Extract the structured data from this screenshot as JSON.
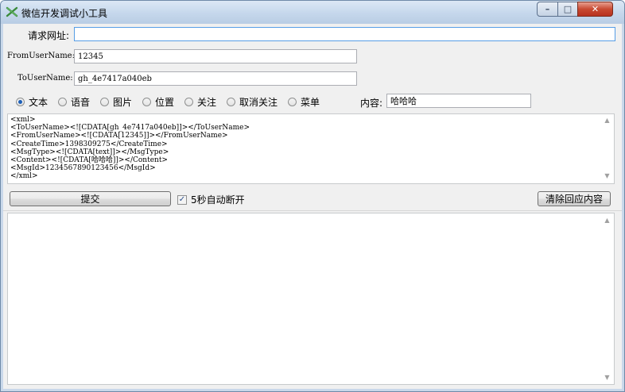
{
  "window": {
    "title": "微信开发调试小工具",
    "controls": {
      "minimize": "–",
      "maximize": "□",
      "close": "✕"
    }
  },
  "form": {
    "url_label": "请求网址:",
    "url_value": "",
    "from_label": "FromUserName:",
    "from_value": "12345",
    "to_label": "ToUserName:",
    "to_value": "gh_4e7417a040eb",
    "content_label": "内容:",
    "content_value": "哈哈哈"
  },
  "message_types": [
    {
      "label": "文本",
      "checked": true
    },
    {
      "label": "语音",
      "checked": false
    },
    {
      "label": "图片",
      "checked": false
    },
    {
      "label": "位置",
      "checked": false
    },
    {
      "label": "关注",
      "checked": false
    },
    {
      "label": "取消关注",
      "checked": false
    },
    {
      "label": "菜单",
      "checked": false
    }
  ],
  "xml_lines": [
    "<xml>",
    "<ToUserName><![CDATA[gh_4e7417a040eb]]></ToUserName>",
    "<FromUserName><![CDATA[12345]]></FromUserName>",
    "<CreateTime>1398309275</CreateTime>",
    "<MsgType><![CDATA[text]]></MsgType>",
    "<Content><![CDATA[哈哈哈]]></Content>",
    "<MsgId>1234567890123456</MsgId>",
    "</xml>"
  ],
  "actions": {
    "submit_label": "提交",
    "auto_disconnect_label": "5秒自动断开",
    "auto_disconnect_checked": true,
    "clear_label": "清除回应内容"
  },
  "response": {
    "text": ""
  },
  "scroll": {
    "up": "▲",
    "down": "▼"
  }
}
